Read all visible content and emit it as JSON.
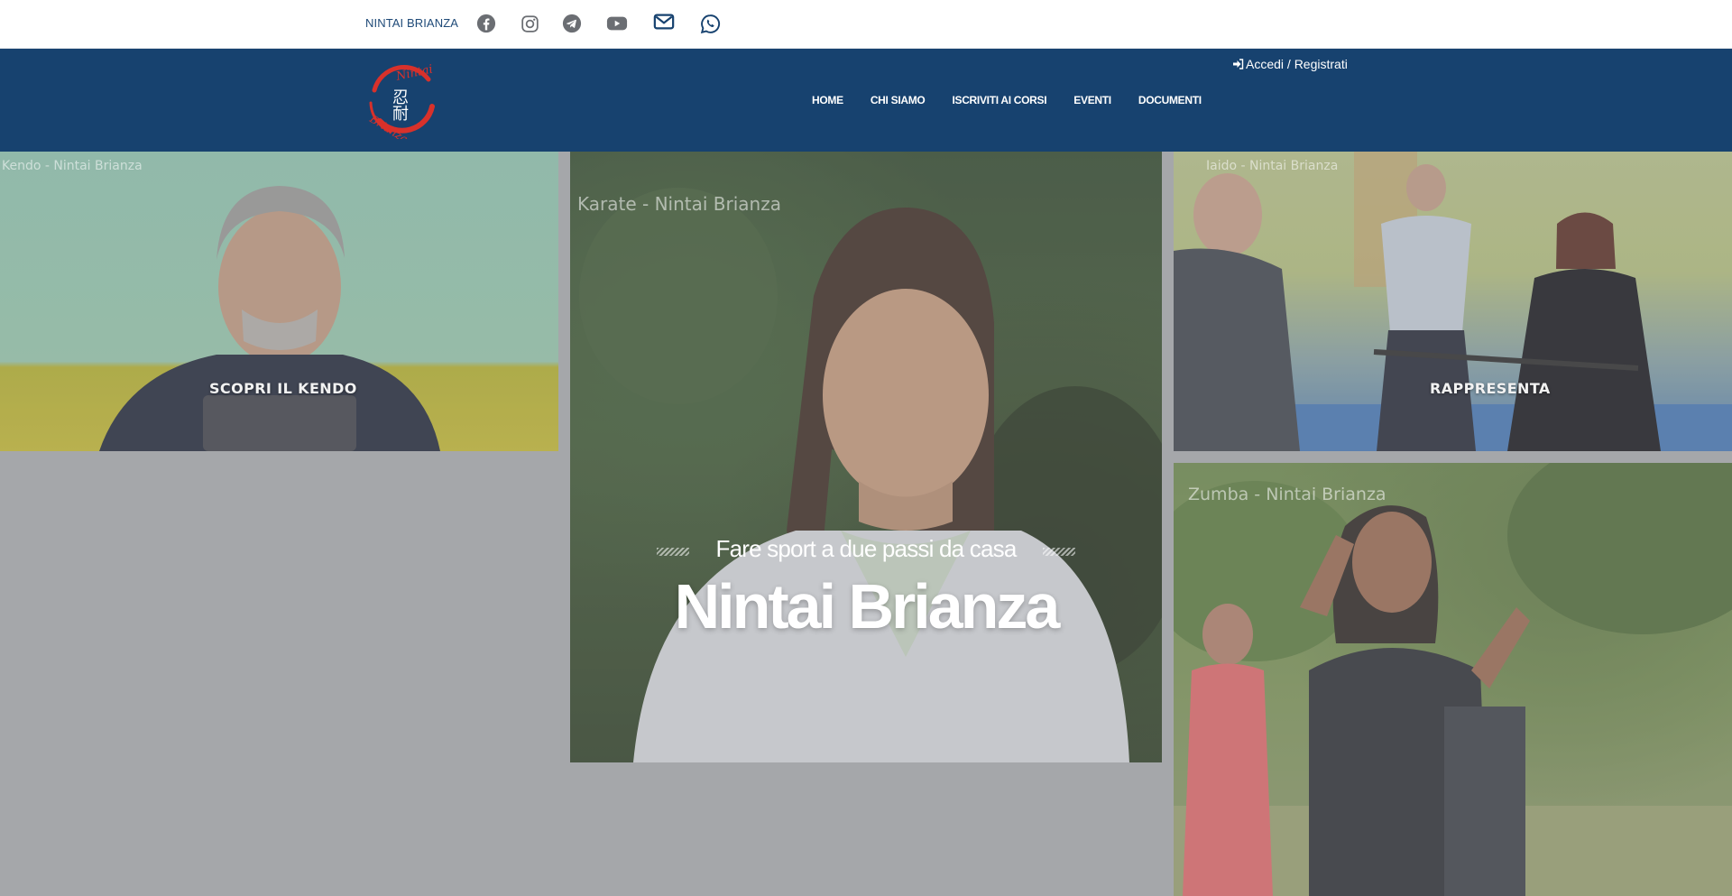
{
  "topbar": {
    "brand": "NINTAI BRIANZA",
    "social_icons": [
      "facebook-icon",
      "instagram-icon",
      "telegram-icon",
      "youtube-icon",
      "mail-icon",
      "whatsapp-icon"
    ]
  },
  "header": {
    "login_label": "Accedi / Registrati",
    "nav": [
      {
        "label": "HOME"
      },
      {
        "label": "CHI SIAMO"
      },
      {
        "label": "ISCRIVITI AI CORSI"
      },
      {
        "label": "EVENTI"
      },
      {
        "label": "DOCUMENTI"
      }
    ],
    "logo_text": [
      "Nintai",
      "忍",
      "耐",
      "Brianza"
    ]
  },
  "panels": {
    "kendo": {
      "caption": "Kendo - Nintai Brianza",
      "cta": "SCOPRI IL KENDO"
    },
    "karate": {
      "caption": "Karate - Nintai Brianza"
    },
    "iaido": {
      "caption": "Iaido - Nintai Brianza",
      "cta": "RAPPRESENTA"
    },
    "zumba": {
      "caption": "Zumba - Nintai Brianza"
    }
  },
  "hero": {
    "subtitle": "Fare sport a due passi da casa",
    "title": "Nintai Brianza"
  },
  "colors": {
    "header_bg": "#17426f",
    "brand_text": "#1f4a78",
    "social_icon": "#6b6e73",
    "social_icon_dark": "#17426f",
    "logo_red": "#d8312b",
    "page_bg": "#a5a7aa"
  }
}
